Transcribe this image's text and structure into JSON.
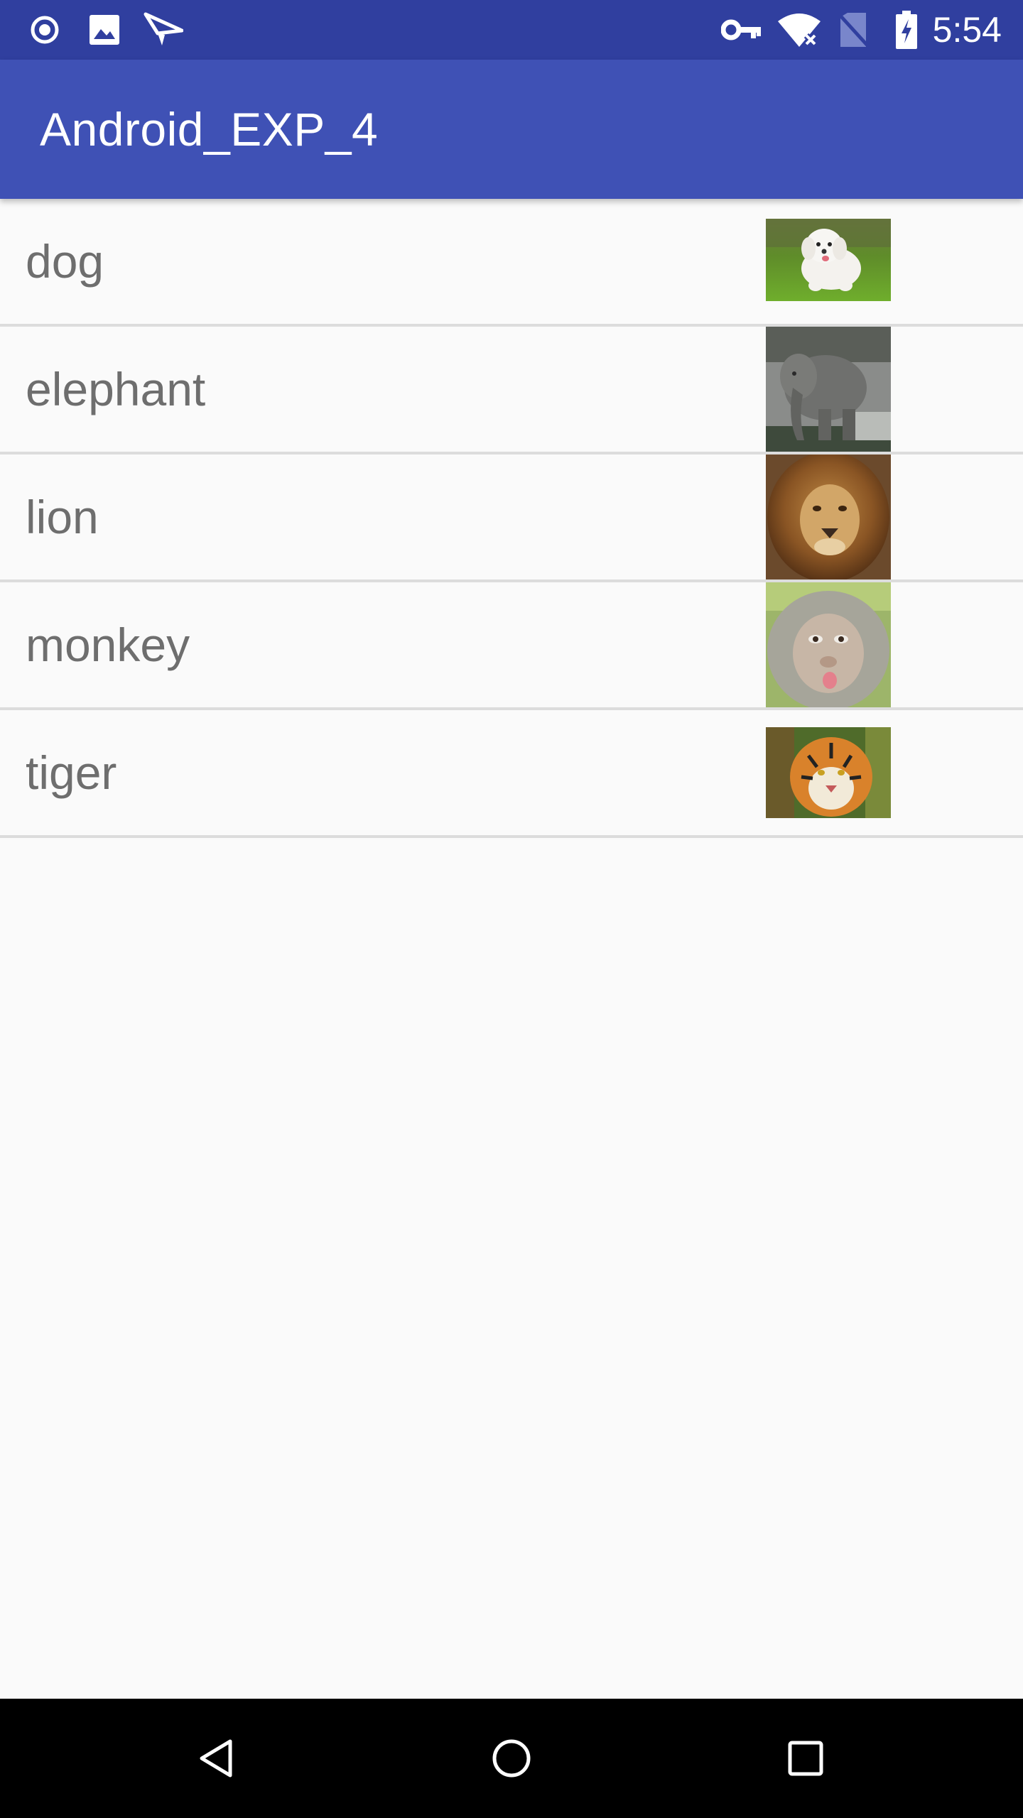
{
  "status_bar": {
    "time": "5:54",
    "left_icons": [
      "radio-button-icon",
      "image-icon",
      "send-icon"
    ],
    "right_icons": [
      "vpn-key-icon",
      "wifi-no-internet-icon",
      "no-sim-icon",
      "battery-charging-icon"
    ]
  },
  "app_bar": {
    "title": "Android_EXP_4",
    "color": "#3f51b5",
    "status_color": "#303f9f"
  },
  "list": {
    "items": [
      {
        "label": "dog",
        "image": "dog-thumbnail"
      },
      {
        "label": "elephant",
        "image": "elephant-thumbnail"
      },
      {
        "label": "lion",
        "image": "lion-thumbnail"
      },
      {
        "label": "monkey",
        "image": "monkey-thumbnail"
      },
      {
        "label": "tiger",
        "image": "tiger-thumbnail"
      }
    ]
  },
  "nav_bar": {
    "buttons": [
      "back-icon",
      "home-icon",
      "recents-icon"
    ]
  }
}
